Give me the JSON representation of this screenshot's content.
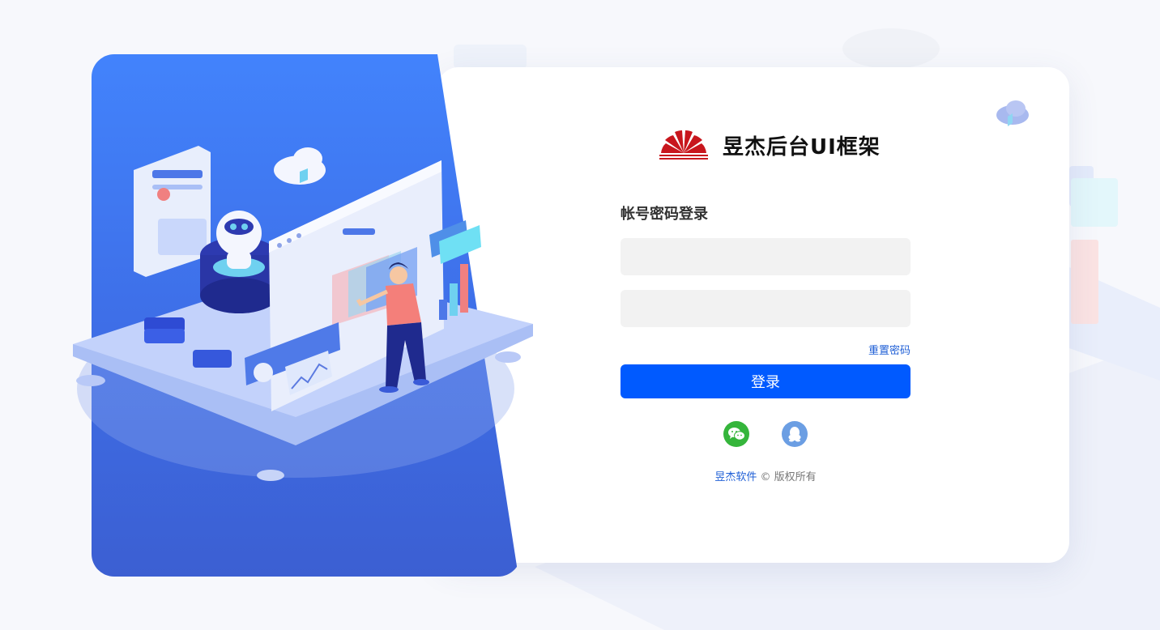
{
  "brand": {
    "name": "昱杰后台UI框架",
    "logo_icon": "sun-rays-logo-icon",
    "logo_color": "#c8161d"
  },
  "login": {
    "title": "帐号密码登录",
    "username_placeholder": "",
    "password_placeholder": "",
    "reset_password_label": "重置密码",
    "submit_label": "登录"
  },
  "social": {
    "wechat_icon": "wechat-icon",
    "qq_icon": "qq-icon"
  },
  "footer": {
    "company": "昱杰软件",
    "copyright_symbol": "©",
    "rights": "版权所有"
  },
  "colors": {
    "primary": "#005aff",
    "link": "#1f5fd6",
    "panel_blue": "#4283fc",
    "wechat": "#35b53b",
    "qq": "#6b9ee3"
  }
}
